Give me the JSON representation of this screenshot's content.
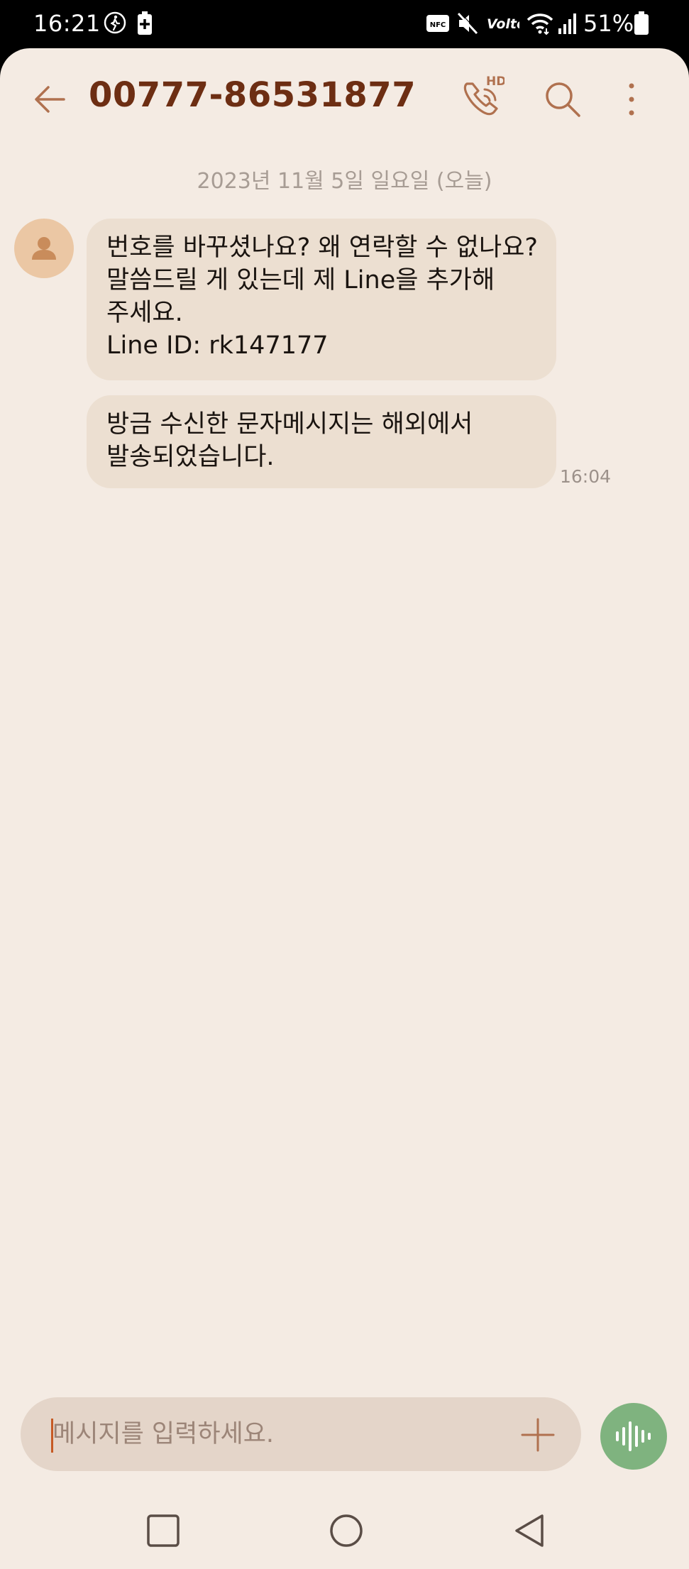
{
  "status_bar": {
    "time": "16:21",
    "battery_percent": "51%",
    "icons": [
      "walking-icon",
      "battery-plus-icon",
      "nfc-icon",
      "mute-icon",
      "volte-icon",
      "wifi-icon",
      "signal-icon",
      "battery-icon"
    ],
    "nfc_label": "NFC",
    "volte_label": "Volte"
  },
  "header": {
    "title": "00777-86531877",
    "call_badge": "HD"
  },
  "conversation": {
    "date_separator": "2023년 11월 5일 일요일 (오늘)",
    "messages": [
      {
        "lines": [
          "번호를 바꾸셨나요? 왜 연락할 수 없나요?",
          "말씀드릴 게 있는데 제 Line을 추가해",
          "주세요.",
          "Line ID: rk147177"
        ]
      },
      {
        "lines": [
          "방금 수신한 문자메시지는 해외에서",
          "발송되었습니다."
        ],
        "time": "16:04"
      }
    ]
  },
  "composer": {
    "placeholder": "메시지를 입력하세요."
  },
  "colors": {
    "background": "#f4ebe3",
    "title": "#6d2e13",
    "bubble": "#ecdfd1",
    "accent_icon": "#b0714f",
    "voice_button": "#7fb37f"
  }
}
